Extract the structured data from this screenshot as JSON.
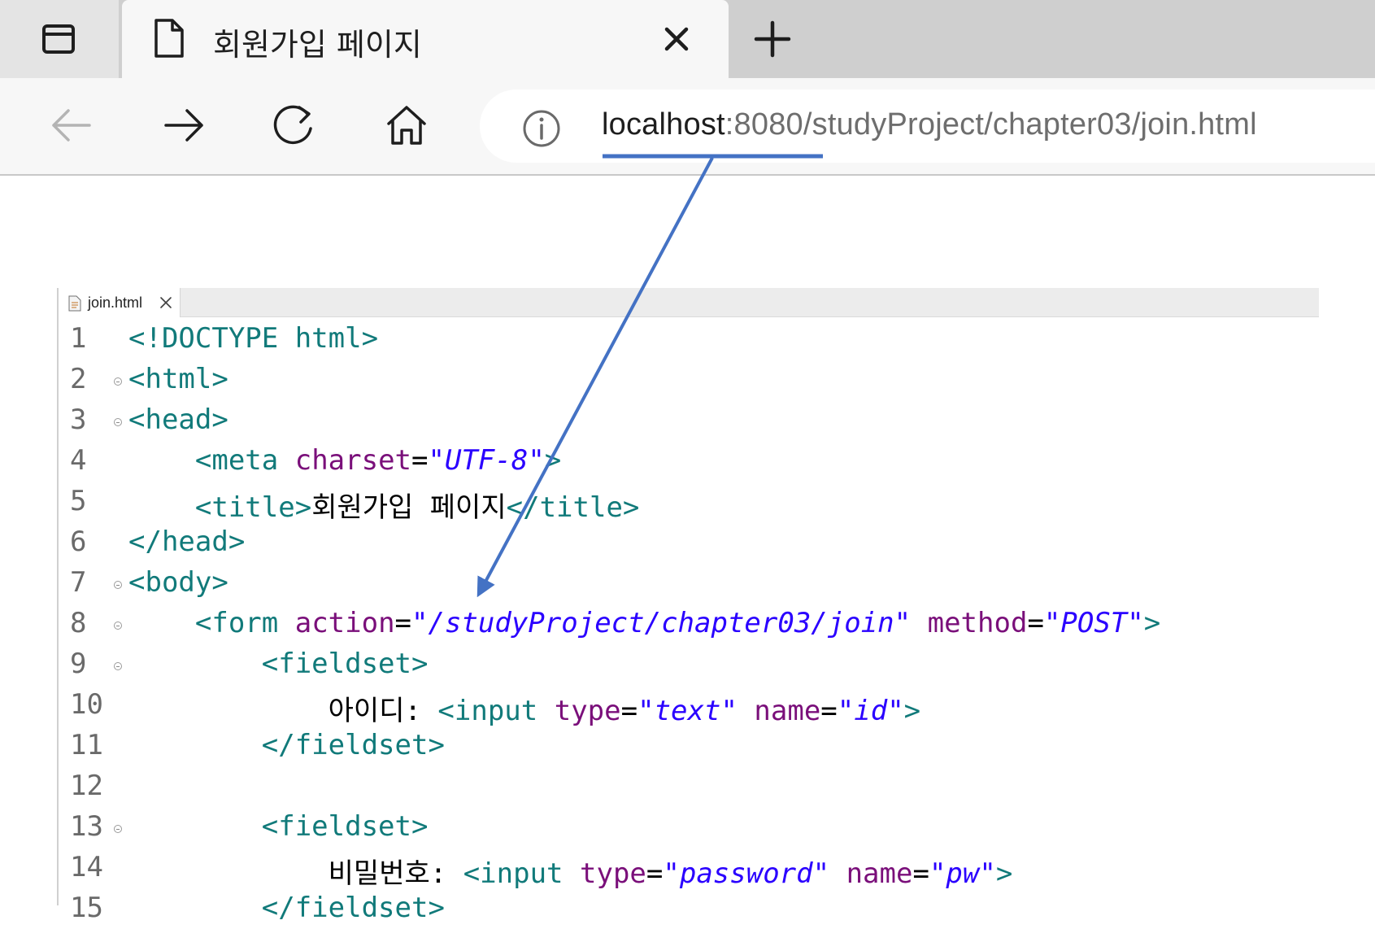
{
  "browser": {
    "tab": {
      "title": "회원가입 페이지"
    },
    "address": {
      "host": "localhost",
      "rest": ":8080/studyProject/chapter03/join.html"
    }
  },
  "editor": {
    "file_tab": "join.html",
    "lines": [
      {
        "n": "1",
        "fold": false,
        "tokens": [
          [
            "t",
            "<!DOCTYPE html>"
          ]
        ]
      },
      {
        "n": "2",
        "fold": true,
        "tokens": [
          [
            "t",
            "<html>"
          ]
        ]
      },
      {
        "n": "3",
        "fold": true,
        "tokens": [
          [
            "t",
            "<head>"
          ]
        ]
      },
      {
        "n": "4",
        "fold": false,
        "tokens": [
          [
            "p",
            "    "
          ],
          [
            "t",
            "<meta "
          ],
          [
            "a",
            "charset"
          ],
          [
            "p",
            "="
          ],
          [
            "v",
            "\"UTF-8\""
          ],
          [
            "t",
            ">"
          ]
        ]
      },
      {
        "n": "5",
        "fold": false,
        "tokens": [
          [
            "p",
            "    "
          ],
          [
            "t",
            "<title>"
          ],
          [
            "p",
            "회원가입 페이지"
          ],
          [
            "t",
            "</title>"
          ]
        ]
      },
      {
        "n": "6",
        "fold": false,
        "tokens": [
          [
            "t",
            "</head>"
          ]
        ]
      },
      {
        "n": "7",
        "fold": true,
        "tokens": [
          [
            "t",
            "<body>"
          ]
        ]
      },
      {
        "n": "8",
        "fold": true,
        "tokens": [
          [
            "p",
            "    "
          ],
          [
            "t",
            "<form "
          ],
          [
            "a",
            "action"
          ],
          [
            "p",
            "="
          ],
          [
            "v",
            "\"/studyProject/chapter03/join\""
          ],
          [
            "p",
            " "
          ],
          [
            "a",
            "method"
          ],
          [
            "p",
            "="
          ],
          [
            "v",
            "\"POST\""
          ],
          [
            "t",
            ">"
          ]
        ]
      },
      {
        "n": "9",
        "fold": true,
        "tokens": [
          [
            "p",
            "        "
          ],
          [
            "t",
            "<fieldset>"
          ]
        ]
      },
      {
        "n": "10",
        "fold": false,
        "tokens": [
          [
            "p",
            "            아이디: "
          ],
          [
            "t",
            "<input "
          ],
          [
            "a",
            "type"
          ],
          [
            "p",
            "="
          ],
          [
            "v",
            "\"text\""
          ],
          [
            "p",
            " "
          ],
          [
            "a",
            "name"
          ],
          [
            "p",
            "="
          ],
          [
            "v",
            "\"id\""
          ],
          [
            "t",
            ">"
          ]
        ]
      },
      {
        "n": "11",
        "fold": false,
        "tokens": [
          [
            "p",
            "        "
          ],
          [
            "t",
            "</fieldset>"
          ]
        ]
      },
      {
        "n": "12",
        "fold": false,
        "tokens": []
      },
      {
        "n": "13",
        "fold": true,
        "tokens": [
          [
            "p",
            "        "
          ],
          [
            "t",
            "<fieldset>"
          ]
        ]
      },
      {
        "n": "14",
        "fold": false,
        "tokens": [
          [
            "p",
            "            비밀번호: "
          ],
          [
            "t",
            "<input "
          ],
          [
            "a",
            "type"
          ],
          [
            "p",
            "="
          ],
          [
            "v",
            "\"password\""
          ],
          [
            "p",
            " "
          ],
          [
            "a",
            "name"
          ],
          [
            "p",
            "="
          ],
          [
            "v",
            "\"pw\""
          ],
          [
            "t",
            ">"
          ]
        ]
      },
      {
        "n": "15",
        "fold": false,
        "tokens": [
          [
            "p",
            "        "
          ],
          [
            "t",
            "</fieldset>"
          ]
        ]
      }
    ]
  },
  "colors": {
    "tag": "#117a7a",
    "attribute": "#7a0f7a",
    "value": "#2a00ff",
    "annotation": "#4472c4"
  }
}
